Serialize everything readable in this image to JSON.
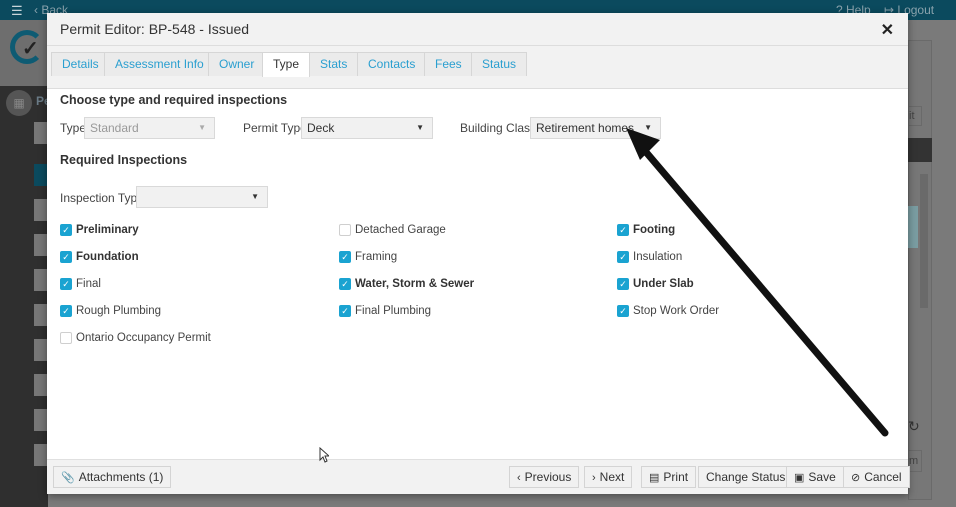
{
  "background_app": {
    "back_label": "Back",
    "help_label": "Help",
    "logout_label": "Logout",
    "sidebar_section_label": "Pe",
    "right_button_1": "it",
    "right_button_2": "m"
  },
  "modal": {
    "title": "Permit Editor: BP-548 - Issued",
    "close_icon": "close-icon",
    "tabs": [
      {
        "label": "Details",
        "active": false
      },
      {
        "label": "Assessment Info",
        "active": false
      },
      {
        "label": "Owner",
        "active": false
      },
      {
        "label": "Type",
        "active": true
      },
      {
        "label": "Stats",
        "active": false
      },
      {
        "label": "Contacts",
        "active": false
      },
      {
        "label": "Fees",
        "active": false
      },
      {
        "label": "Status",
        "active": false
      }
    ],
    "section_title": "Choose type and required inspections",
    "fields": {
      "type_label": "Type",
      "type_value": "Standard",
      "permit_type_label": "Permit Type",
      "permit_type_value": "Deck",
      "building_class_label": "Building Class",
      "building_class_value": "Retirement homes"
    },
    "required_inspections_title": "Required Inspections",
    "inspection_type_label": "Inspection Type",
    "inspection_type_value": "",
    "inspections": [
      {
        "label": "Preliminary",
        "checked": true,
        "bold": true
      },
      {
        "label": "Foundation",
        "checked": true,
        "bold": true
      },
      {
        "label": "Final",
        "checked": true,
        "bold": false
      },
      {
        "label": "Rough Plumbing",
        "checked": true,
        "bold": false
      },
      {
        "label": "Ontario Occupancy Permit",
        "checked": false,
        "bold": false
      },
      {
        "label": "Detached Garage",
        "checked": false,
        "bold": false
      },
      {
        "label": "Framing",
        "checked": true,
        "bold": false
      },
      {
        "label": "Water, Storm & Sewer",
        "checked": true,
        "bold": true
      },
      {
        "label": "Final Plumbing",
        "checked": true,
        "bold": false
      },
      {
        "label": "Footing",
        "checked": true,
        "bold": true
      },
      {
        "label": "Insulation",
        "checked": true,
        "bold": false
      },
      {
        "label": "Under Slab",
        "checked": true,
        "bold": true
      },
      {
        "label": "Stop Work Order",
        "checked": true,
        "bold": false
      }
    ],
    "footer": {
      "attachments_label": "Attachments (1)",
      "previous_label": "Previous",
      "next_label": "Next",
      "print_label": "Print",
      "change_status_label": "Change Status",
      "save_label": "Save",
      "cancel_label": "Cancel"
    }
  },
  "icons": {
    "caret": "▼",
    "check": "✓",
    "close": "✕",
    "prev": "‹",
    "next": "›"
  }
}
